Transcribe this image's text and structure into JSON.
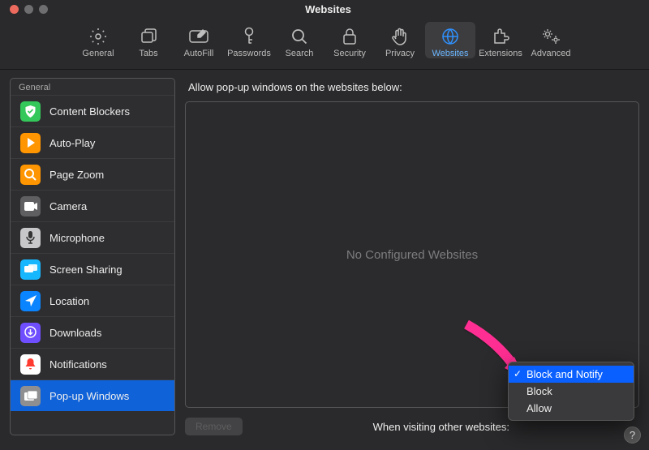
{
  "window": {
    "title": "Websites"
  },
  "traffic": {
    "close": "#ed6a5e",
    "minimize": "#6e6e70",
    "zoom": "#6e6e70"
  },
  "toolbar": {
    "items": [
      {
        "label": "General",
        "icon": "gear"
      },
      {
        "label": "Tabs",
        "icon": "tabs"
      },
      {
        "label": "AutoFill",
        "icon": "autofill"
      },
      {
        "label": "Passwords",
        "icon": "key"
      },
      {
        "label": "Search",
        "icon": "search"
      },
      {
        "label": "Security",
        "icon": "lock"
      },
      {
        "label": "Privacy",
        "icon": "hand"
      },
      {
        "label": "Websites",
        "icon": "globe",
        "selected": true
      },
      {
        "label": "Extensions",
        "icon": "puzzle"
      },
      {
        "label": "Advanced",
        "icon": "gears"
      }
    ]
  },
  "sidebar": {
    "header": "General",
    "items": [
      {
        "label": "Content Blockers",
        "icon": "shield",
        "bg": "#34c759"
      },
      {
        "label": "Auto-Play",
        "icon": "play",
        "bg": "#ff9500"
      },
      {
        "label": "Page Zoom",
        "icon": "zoom",
        "bg": "#ff9500"
      },
      {
        "label": "Camera",
        "icon": "camera",
        "bg": "#5f5f61"
      },
      {
        "label": "Microphone",
        "icon": "mic",
        "bg": "#c7c7ca"
      },
      {
        "label": "Screen Sharing",
        "icon": "screens",
        "bg": "#17b7ff"
      },
      {
        "label": "Location",
        "icon": "location",
        "bg": "#0a84ff"
      },
      {
        "label": "Downloads",
        "icon": "download",
        "bg": "#6f4eff"
      },
      {
        "label": "Notifications",
        "icon": "bell",
        "bg": "#ffffff"
      },
      {
        "label": "Pop-up Windows",
        "icon": "popup",
        "bg": "#8f8f91",
        "selected": true
      }
    ]
  },
  "content": {
    "heading": "Allow pop-up windows on the websites below:",
    "empty_text": "No Configured Websites",
    "remove_label": "Remove",
    "bottom_label": "When visiting other websites:"
  },
  "dropdown": {
    "options": [
      {
        "label": "Block and Notify",
        "selected": true
      },
      {
        "label": "Block"
      },
      {
        "label": "Allow"
      }
    ]
  },
  "help": {
    "label": "?"
  }
}
